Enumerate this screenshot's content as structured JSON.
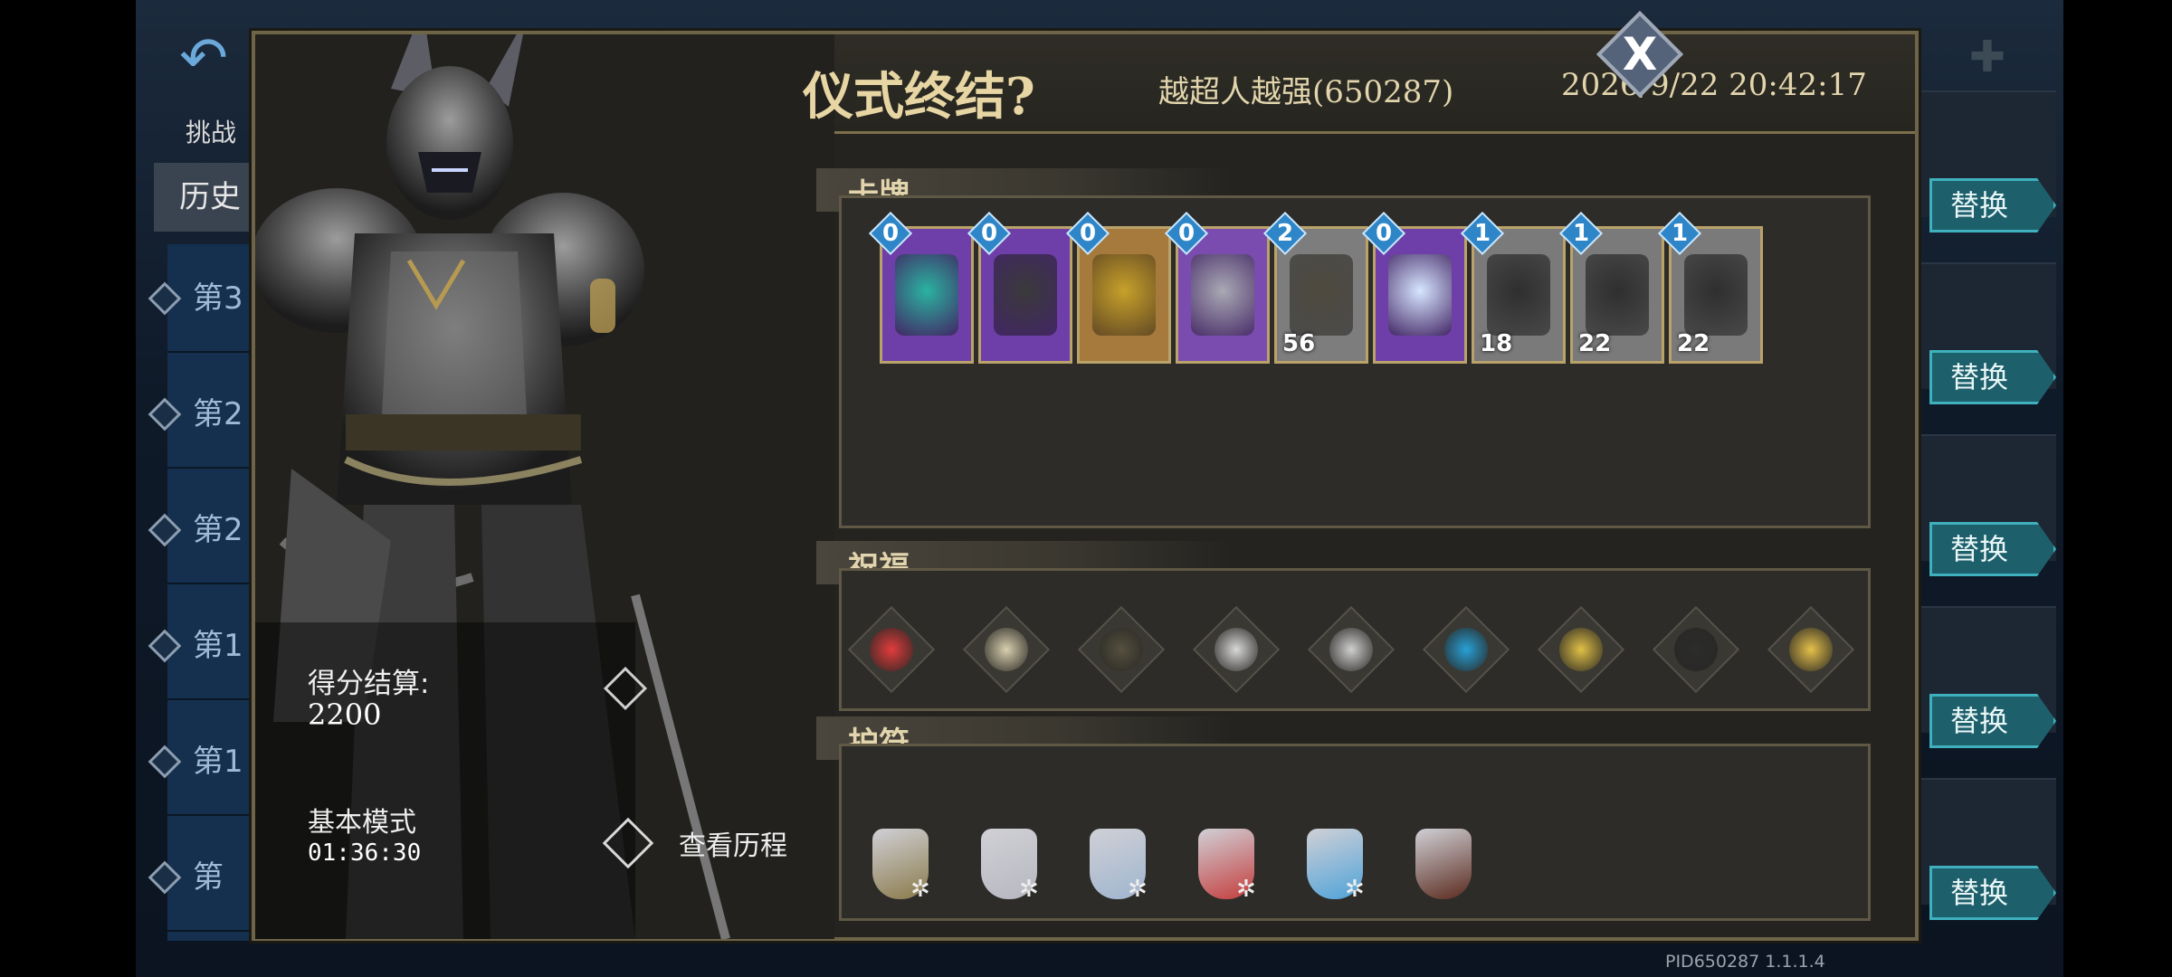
{
  "background": {
    "tab_label": "挑战",
    "history_tab": "历史",
    "list_items": [
      "第3",
      "第2",
      "第2",
      "第1",
      "第1",
      "第"
    ],
    "replace_buttons": [
      "替换",
      "替换",
      "替换",
      "替换",
      "替换"
    ],
    "version": "PID650287  1.1.1.4"
  },
  "modal": {
    "title": "仪式终结?",
    "player": "越超人越强(650287)",
    "datetime": "2026/9/22 20:42:17",
    "close_label": "X",
    "score_label": "得分结算:",
    "score_value": "2200",
    "mode_label": "基本模式",
    "mode_time": "01:36:30",
    "view_history": "查看历程",
    "cards_title": "卡牌",
    "blessings_title": "祝福",
    "amulets_title": "护符",
    "cards": [
      {
        "cost": "0",
        "num": "",
        "color": "#6e3fa8",
        "art": "#2ab3a0"
      },
      {
        "cost": "0",
        "num": "",
        "color": "#6e3fa8",
        "art": "#3a3a3a"
      },
      {
        "cost": "0",
        "num": "",
        "color": "#a57a3c",
        "art": "#c7a12a"
      },
      {
        "cost": "0",
        "num": "",
        "color": "#7a4cb0",
        "art": "#a9a9b4"
      },
      {
        "cost": "2",
        "num": "56",
        "color": "#7d7d7d",
        "art": "#4e4a3e"
      },
      {
        "cost": "0",
        "num": "",
        "color": "#6e3fa8",
        "art": "#d7e6ff"
      },
      {
        "cost": "1",
        "num": "18",
        "color": "#7a7a7a",
        "art": "#2f2f2f"
      },
      {
        "cost": "1",
        "num": "22",
        "color": "#7a7a7a",
        "art": "#2f2f2f"
      },
      {
        "cost": "1",
        "num": "22",
        "color": "#7a7a7a",
        "art": "#2f2f2f"
      }
    ],
    "blessings": [
      {
        "icon": "rune-icon",
        "color": "#e23c3c"
      },
      {
        "icon": "figure-icon",
        "color": "#d8cfae"
      },
      {
        "icon": "chest-icon",
        "color": "#55503f"
      },
      {
        "icon": "cracked-egg-icon",
        "color": "#d8d8d8"
      },
      {
        "icon": "gear-sword-icon",
        "color": "#cfcfcf"
      },
      {
        "icon": "crystal-icon",
        "color": "#28a0d6"
      },
      {
        "icon": "armor-icon",
        "color": "#e0c046"
      },
      {
        "icon": "assassin-icon",
        "color": "#2c2c2c"
      },
      {
        "icon": "gold-star-icon",
        "color": "#e5c04a"
      }
    ],
    "amulets": [
      {
        "icon": "crossed-hammers-icon",
        "color": "#8a7a4a"
      },
      {
        "icon": "horseshoe-icon",
        "color": "#b7b7bf"
      },
      {
        "icon": "lightning-stone-icon",
        "color": "#9fb5cf"
      },
      {
        "icon": "red-ring-icon",
        "color": "#c43d3d"
      },
      {
        "icon": "blue-horseshoe-icon",
        "color": "#4fa3d9"
      },
      {
        "icon": "banner-icon",
        "color": "#5a2a1e"
      }
    ]
  }
}
